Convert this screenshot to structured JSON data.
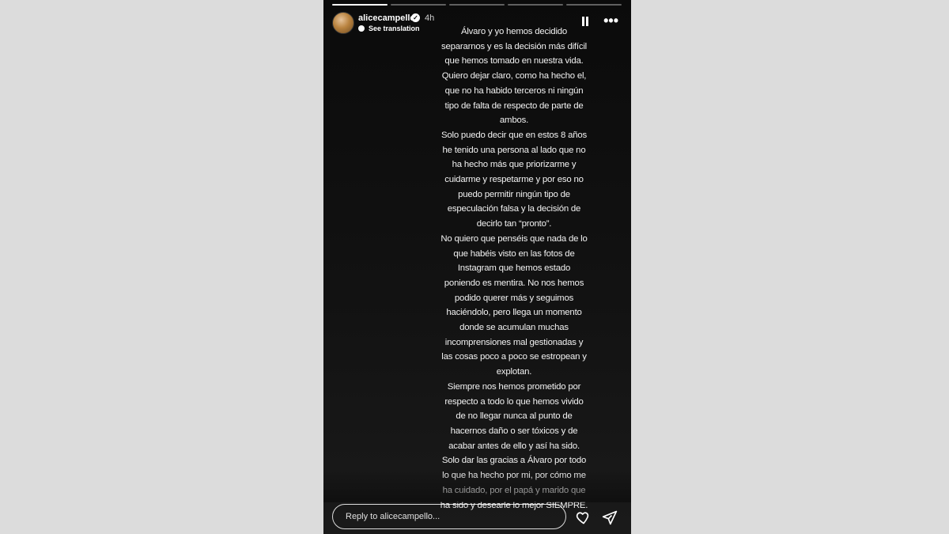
{
  "story": {
    "username": "alicecampello",
    "time": "4h",
    "translation_label": "See translation",
    "progress": [
      1,
      0,
      0,
      0,
      0
    ],
    "text_lines": [
      "Álvaro y yo hemos decidido",
      "separarnos y es la decisión más difícil",
      "que hemos tomado en nuestra vida.",
      "Quiero dejar claro, como ha hecho el,",
      "que no ha habido terceros ni ningún",
      "tipo de falta de respecto de parte de",
      "ambos.",
      "Solo puedo decir que en estos 8 años",
      "he tenido una persona al lado que no",
      "ha hecho más que priorizarme y",
      "cuidarme y respetarme y por eso no",
      "puedo permitir ningún tipo de",
      "especulación falsa y la decisión de",
      "decirlo tan “pronto”.",
      "No quiero que penséis que nada de lo",
      "que habéis visto en las fotos de",
      "Instagram que hemos estado",
      "poniendo es mentira. No nos hemos",
      "podido querer más y seguimos",
      "haciéndolo, pero llega un momento",
      "donde se acumulan muchas",
      "incomprensiones mal gestionadas y",
      "las cosas poco a poco se estropean y",
      "explotan.",
      "Siempre nos hemos prometido por",
      "respecto a todo lo que hemos vivido",
      "de no llegar nunca al punto de",
      "hacernos daño o ser tóxicos y de",
      "acabar antes de ello y así ha sido.",
      "Solo dar las gracias a Álvaro por todo",
      "lo que ha hecho por mi, por cómo me",
      "ha cuidado, por el papá y marido que",
      "ha sido y desearle lo mejor SIEMPRE."
    ],
    "reply_placeholder": "Reply to alicecampello...",
    "icons": [
      "pause-icon",
      "more-options-icon",
      "heart-icon",
      "send-icon",
      "verified-badge-icon",
      "globe-icon"
    ]
  }
}
